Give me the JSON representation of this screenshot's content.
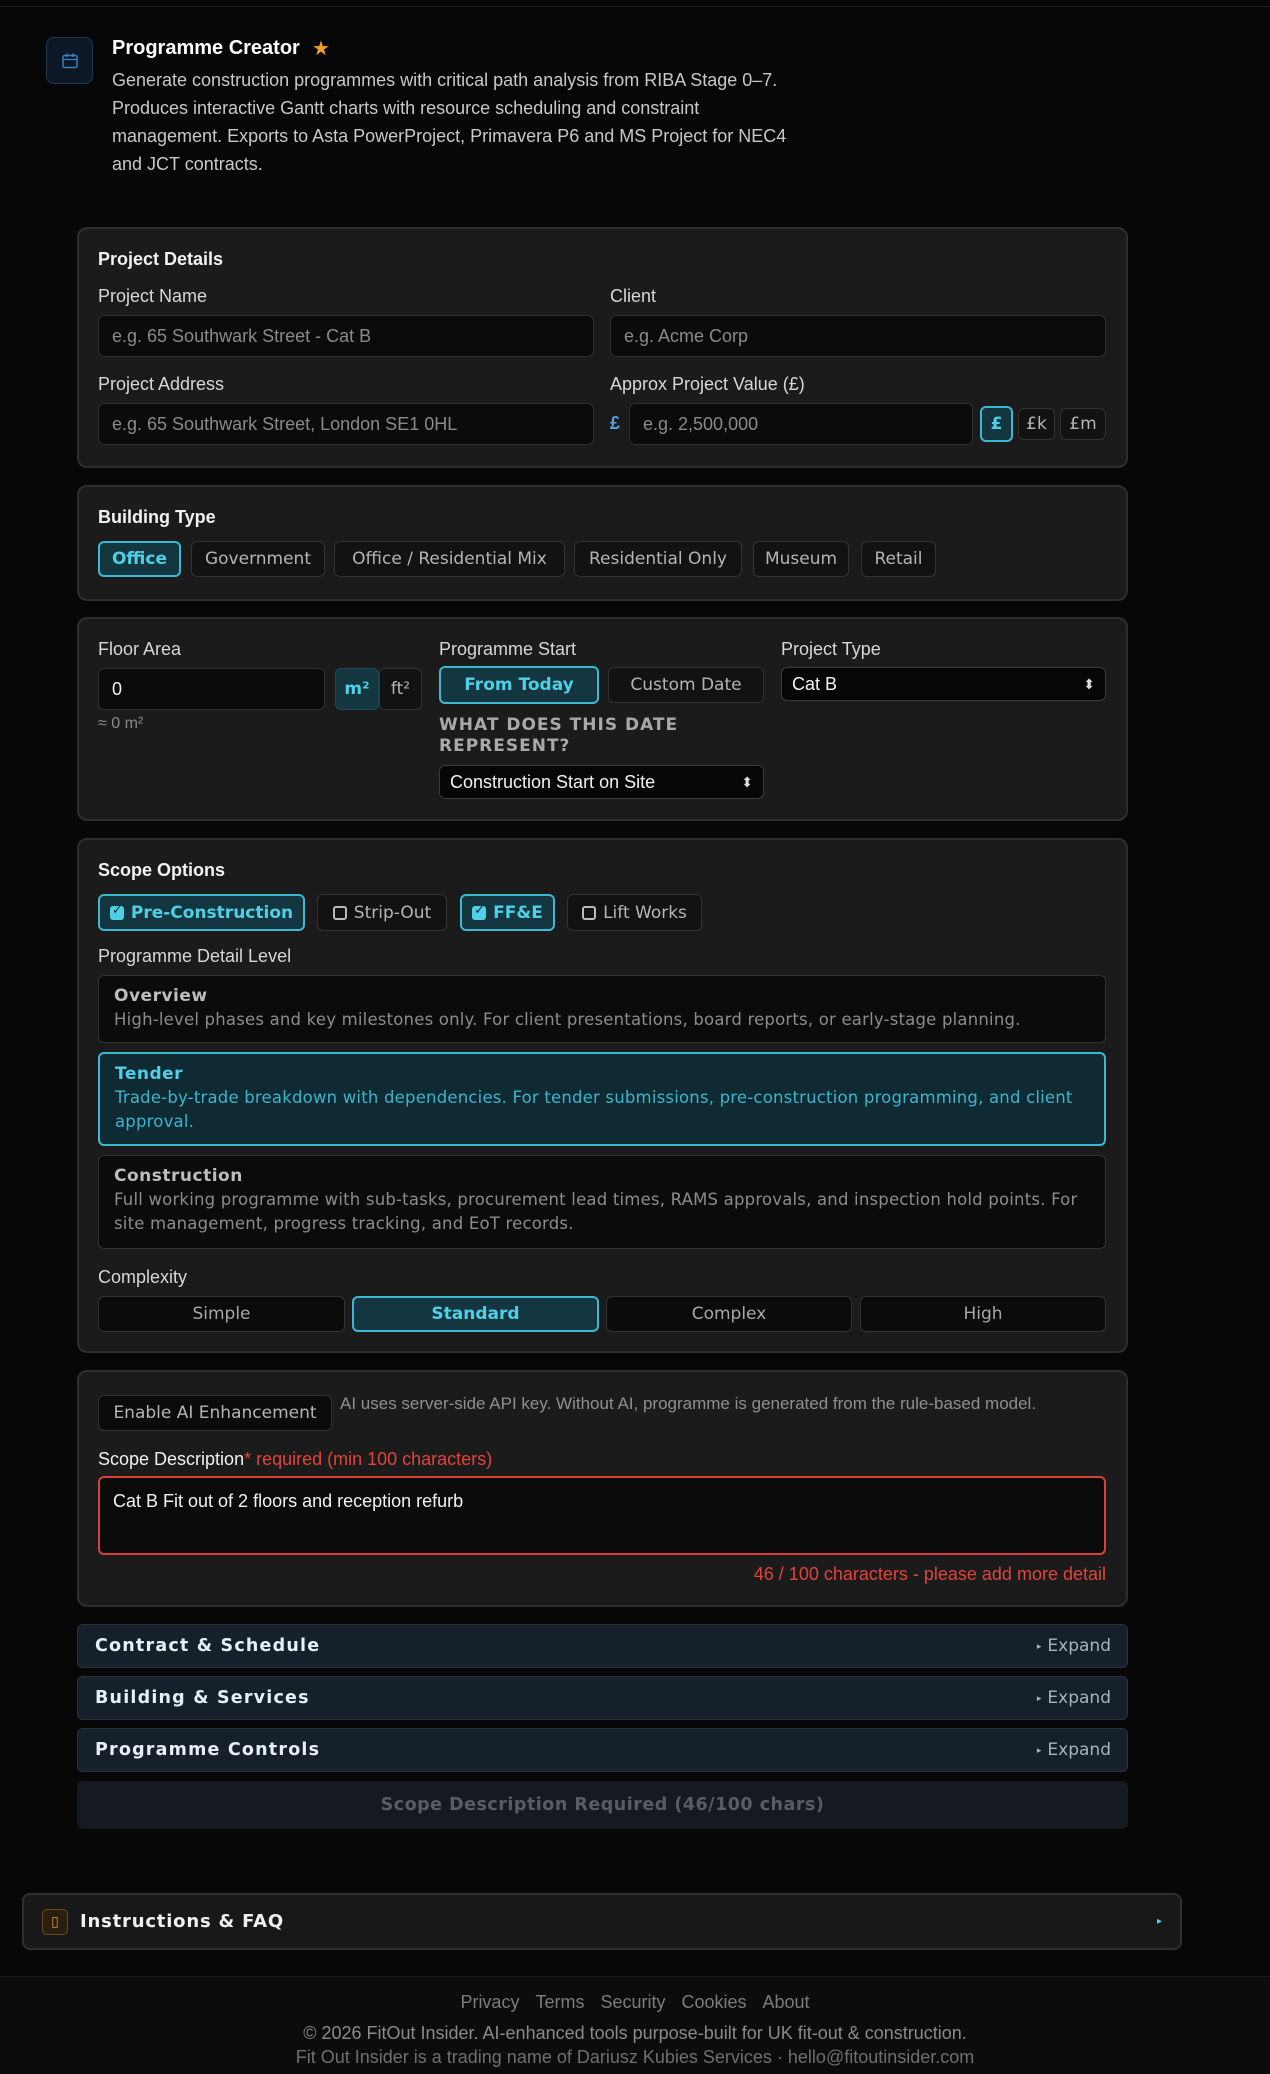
{
  "header": {
    "title": "Programme Creator",
    "description": "Generate construction programmes with critical path analysis from RIBA Stage 0–7. Produces interactive Gantt charts with resource scheduling and constraint management. Exports to Asta PowerProject, Primavera P6 and MS Project for NEC4 and JCT contracts."
  },
  "project_details": {
    "heading": "Project Details",
    "name_label": "Project Name",
    "name_placeholder": "e.g. 65 Southwark Street - Cat B",
    "client_label": "Client",
    "client_placeholder": "e.g. Acme Corp",
    "address_label": "Project Address",
    "address_placeholder": "e.g. 65 Southwark Street, London SE1 0HL",
    "value_label": "Approx Project Value (£)",
    "value_prefix": "£",
    "value_placeholder": "e.g. 2,500,000",
    "units": [
      "£",
      "£k",
      "£m"
    ]
  },
  "building_type": {
    "heading": "Building Type",
    "options": [
      "Office",
      "Government",
      "Office / Residential Mix",
      "Residential Only",
      "Museum",
      "Retail"
    ],
    "selected": "Office"
  },
  "area": {
    "floor_label": "Floor Area",
    "floor_value": "0",
    "unit_m2": "m²",
    "unit_ft2": "ft²",
    "approx": "≈ 0 m²",
    "start_label": "Programme Start",
    "start_today": "From Today",
    "start_custom": "Custom Date",
    "date_question": "WHAT DOES THIS DATE REPRESENT?",
    "date_select": "Construction Start on Site",
    "type_label": "Project Type",
    "type_select": "Cat B"
  },
  "scope": {
    "heading": "Scope Options",
    "options": [
      {
        "label": "Pre-Construction",
        "checked": true
      },
      {
        "label": "Strip-Out",
        "checked": false
      },
      {
        "label": "FF&E",
        "checked": true
      },
      {
        "label": "Lift Works",
        "checked": false
      }
    ],
    "detail_heading": "Programme Detail Level",
    "levels": [
      {
        "title": "Overview",
        "desc": "High-level phases and key milestones only. For client presentations, board reports, or early-stage planning."
      },
      {
        "title": "Tender",
        "desc": "Trade-by-trade breakdown with dependencies. For tender submissions, pre-construction programming, and client approval."
      },
      {
        "title": "Construction",
        "desc": "Full working programme with sub-tasks, procurement lead times, RAMS approvals, and inspection hold points. For site management, progress tracking, and EoT records."
      }
    ],
    "complexity_heading": "Complexity",
    "complexity": [
      "Simple",
      "Standard",
      "Complex",
      "High"
    ]
  },
  "ai": {
    "enable_label": "Enable AI Enhancement",
    "note": "AI uses server-side API key. Without AI, programme is generated from the rule-based model.",
    "scope_label": "Scope Description",
    "required": "* required (min 100 characters)",
    "scope_value": "Cat B Fit out of 2 floors and reception refurb",
    "counter": "46 / 100 characters - please add more detail"
  },
  "accordions": [
    {
      "name": "Contract & Schedule",
      "action": "Expand"
    },
    {
      "name": "Building & Services",
      "action": "Expand"
    },
    {
      "name": "Programme Controls",
      "action": "Expand"
    }
  ],
  "submit_label": "Scope Description Required (46/100 chars)",
  "faq_label": "Instructions & FAQ",
  "footer": {
    "links": [
      "Privacy",
      "Terms",
      "Security",
      "Cookies",
      "About"
    ],
    "copyright": "© 2026 FitOut Insider. AI-enhanced tools purpose-built for UK fit-out & construction.",
    "trading": "Fit Out Insider is a trading name of Dariusz Kubies Services · hello@fitoutinsider.com"
  },
  "colors": {
    "accent": "#4fd0e6",
    "error": "#e0443c",
    "star": "#f0a02a"
  }
}
